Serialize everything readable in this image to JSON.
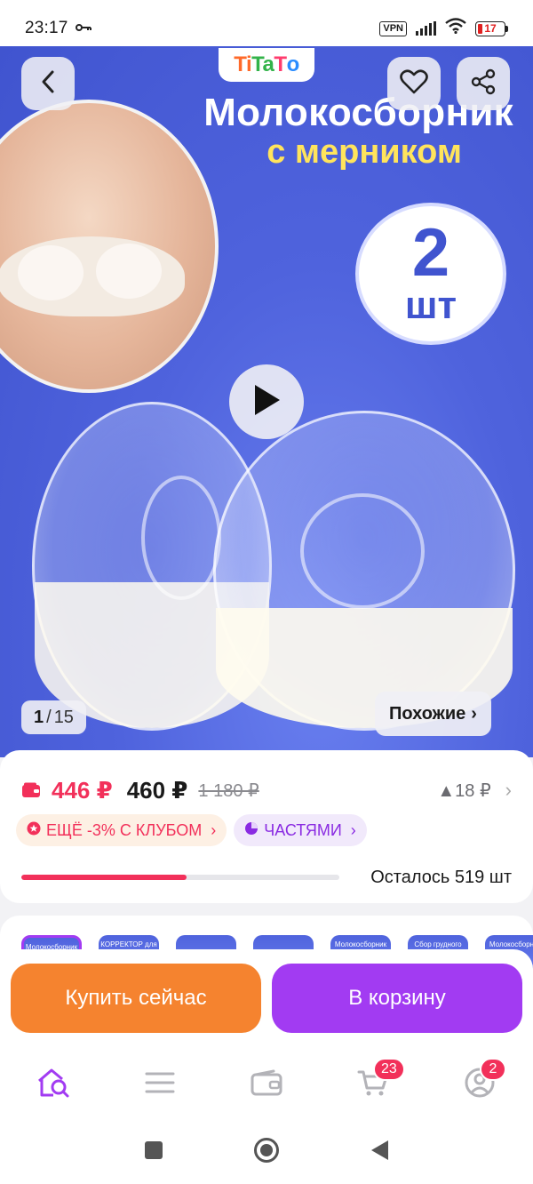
{
  "status_bar": {
    "time": "23:17",
    "key_icon": "key-icon",
    "vpn": "VPN",
    "battery": "17",
    "battery_color": "#e02020"
  },
  "hero": {
    "brand": [
      "Ti",
      "Ta",
      "T",
      "o"
    ],
    "title": "Молокосборник",
    "subtitle": "с мерником",
    "count_number": "2",
    "count_unit": "шт",
    "counter_current": "1",
    "counter_separator": "/",
    "counter_total": "15",
    "similar_label": "Похожие",
    "similar_chevron": "›",
    "icons": {
      "back": "chevron-left-icon",
      "favorite": "heart-icon",
      "share": "share-icon",
      "play": "play-icon"
    }
  },
  "price": {
    "club_price": "446 ₽",
    "price": "460 ₽",
    "old_price": "1 180 ₽",
    "trend": "▲18 ₽",
    "trend_chevron": "›",
    "club_chip": "ЕЩЁ -3% С КЛУБОМ",
    "parts_chip": "ЧАСТЯМИ",
    "chip_chevron": "›",
    "stock_text": "Осталось 519 шт",
    "stock_progress": 0.52,
    "accent_color": "#f2305a"
  },
  "thumbnails": [
    {
      "label": "Молокосборник с мерником",
      "active": true
    },
    {
      "label": "КОРРЕКТОР для сосков",
      "active": false
    },
    {
      "label": "",
      "active": false
    },
    {
      "label": "",
      "active": false
    },
    {
      "label": "Молокосборник",
      "active": false
    },
    {
      "label": "Сбор грудного молока без протечек",
      "active": false
    },
    {
      "label": "Молокосборник",
      "active": false
    }
  ],
  "actions": {
    "buy_now": "Купить сейчас",
    "add_to_cart": "В корзину",
    "buy_color": "#f5832f",
    "cart_color": "#a23bf2"
  },
  "bottom_nav": {
    "items": [
      {
        "name": "home",
        "icon": "home-search-icon"
      },
      {
        "name": "catalog",
        "icon": "menu-icon"
      },
      {
        "name": "wallet",
        "icon": "wallet-icon"
      },
      {
        "name": "cart",
        "icon": "cart-icon",
        "badge": "23"
      },
      {
        "name": "profile",
        "icon": "profile-icon",
        "badge": "2"
      }
    ],
    "active_color": "#a23bf2"
  }
}
